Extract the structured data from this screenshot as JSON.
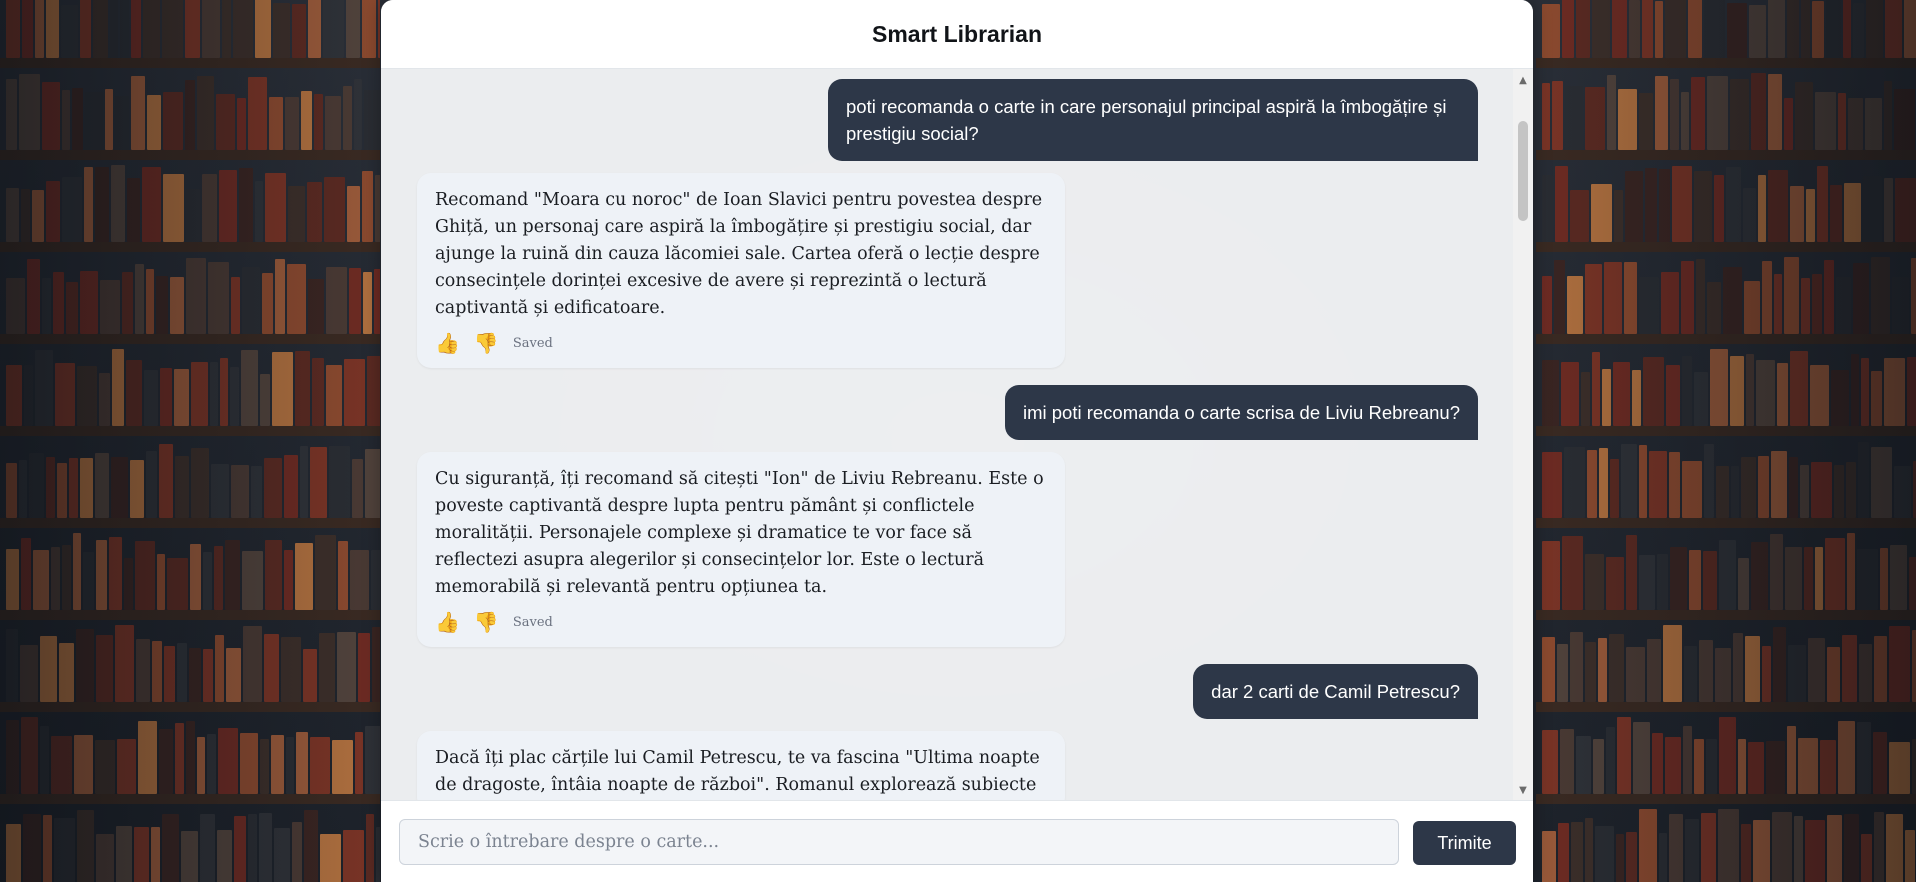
{
  "app": {
    "title": "Smart Librarian"
  },
  "conversation": [
    {
      "role": "user",
      "text": "poti recomanda o carte in care personajul principal aspiră la îmbogățire și prestigiu social?"
    },
    {
      "role": "assistant",
      "text": "Recomand \"Moara cu noroc\" de Ioan Slavici pentru povestea despre Ghiță, un personaj care aspiră la îmbogățire și prestigiu social, dar ajunge la ruină din cauza lăcomiei sale. Cartea oferă o lecție despre consecințele dorinței excesive de avere și reprezintă o lectură captivantă și edificatoare.",
      "status": "Saved"
    },
    {
      "role": "user",
      "text": "imi poti recomanda o carte scrisa de Liviu Rebreanu?"
    },
    {
      "role": "assistant",
      "text": "Cu siguranță, îți recomand să citești \"Ion\" de Liviu Rebreanu. Este o poveste captivantă despre lupta pentru pământ și conflictele moralității. Personajele complexe și dramatice te vor face să reflectezi asupra alegerilor și consecințelor lor. Este o lectură memorabilă și relevantă pentru opțiunea ta.",
      "status": "Saved"
    },
    {
      "role": "user",
      "text": "dar 2 carti de Camil Petrescu?"
    },
    {
      "role": "assistant",
      "text": "Dacă îți plac cărțile lui Camil Petrescu, te va fascina \"Ultima noapte de dragoste, întâia noapte de război\". Romanul explorează subiecte"
    }
  ],
  "feedback": {
    "like_icon": "👍",
    "dislike_icon": "👎"
  },
  "composer": {
    "placeholder": "Scrie o întrebare despre o carte...",
    "value": "",
    "send_label": "Trimite"
  },
  "icons": {
    "scroll_up": "▲",
    "scroll_down": "▼"
  },
  "colors": {
    "user_bubble": "#2d3748",
    "assistant_bubble": "#eef2f7",
    "send_button": "#2d3748"
  }
}
